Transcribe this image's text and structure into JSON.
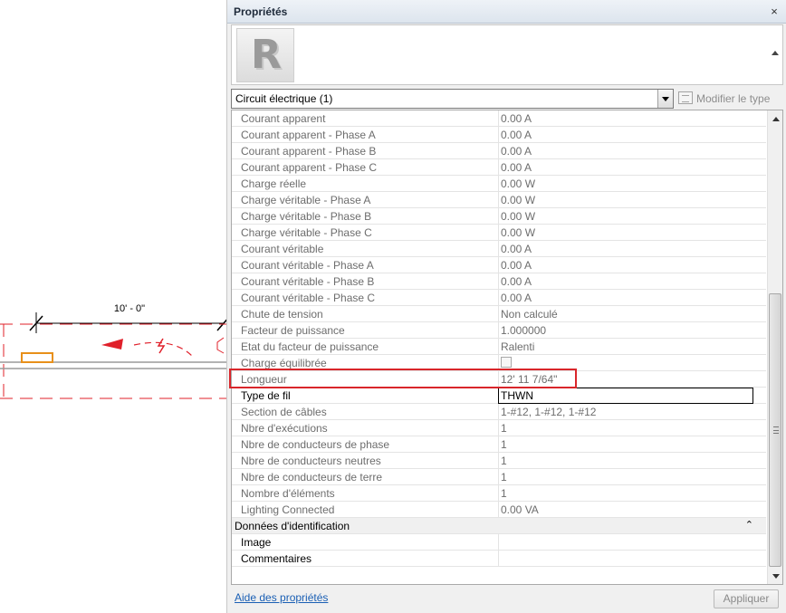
{
  "canvas": {
    "dimension_text": "10' - 0\""
  },
  "palette": {
    "title": "Propriétés",
    "close_glyph": "×",
    "type_image_letter": "R",
    "type_selector": "Circuit électrique (1)",
    "edit_type_label": "Modifier le type",
    "rows": [
      {
        "name": "Courant apparent",
        "value": "0.00 A"
      },
      {
        "name": "Courant apparent - Phase A",
        "value": "0.00 A"
      },
      {
        "name": "Courant apparent - Phase B",
        "value": "0.00 A"
      },
      {
        "name": "Courant apparent - Phase C",
        "value": "0.00 A"
      },
      {
        "name": "Charge réelle",
        "value": "0.00 W"
      },
      {
        "name": "Charge véritable - Phase A",
        "value": "0.00 W"
      },
      {
        "name": "Charge véritable - Phase B",
        "value": "0.00 W"
      },
      {
        "name": "Charge véritable - Phase C",
        "value": "0.00 W"
      },
      {
        "name": "Courant véritable",
        "value": "0.00 A"
      },
      {
        "name": "Courant véritable - Phase A",
        "value": "0.00 A"
      },
      {
        "name": "Courant véritable - Phase B",
        "value": "0.00 A"
      },
      {
        "name": "Courant véritable - Phase C",
        "value": "0.00 A"
      },
      {
        "name": "Chute de tension",
        "value": "Non calculé"
      },
      {
        "name": "Facteur de puissance",
        "value": "1.000000"
      },
      {
        "name": "Etat du facteur de puissance",
        "value": "Ralenti"
      },
      {
        "name": "Charge équilibrée",
        "value": ""
      },
      {
        "name": "Longueur",
        "value": "12'  11 7/64\""
      },
      {
        "name": "Type de fil",
        "value": "THWN"
      },
      {
        "name": "Section de câbles",
        "value": "1-#12, 1-#12, 1-#12"
      },
      {
        "name": "Nbre d'exécutions",
        "value": "1"
      },
      {
        "name": "Nbre de conducteurs de phase",
        "value": "1"
      },
      {
        "name": "Nbre de conducteurs neutres",
        "value": "1"
      },
      {
        "name": "Nbre de conducteurs de terre",
        "value": "1"
      },
      {
        "name": "Nombre d'éléments",
        "value": "1"
      },
      {
        "name": "Lighting Connected",
        "value": "0.00 VA"
      }
    ],
    "group_identification": {
      "label": "Données d'identification",
      "collapse_glyph": "⌃",
      "rows": [
        {
          "name": "Image",
          "value": ""
        },
        {
          "name": "Commentaires",
          "value": ""
        }
      ]
    },
    "help_link": "Aide des propriétés",
    "apply_label": "Appliquer"
  },
  "colors": {
    "highlight": "#d9262b",
    "wire_dashed": "#e0202a",
    "fixture_orange": "#e8901a"
  }
}
